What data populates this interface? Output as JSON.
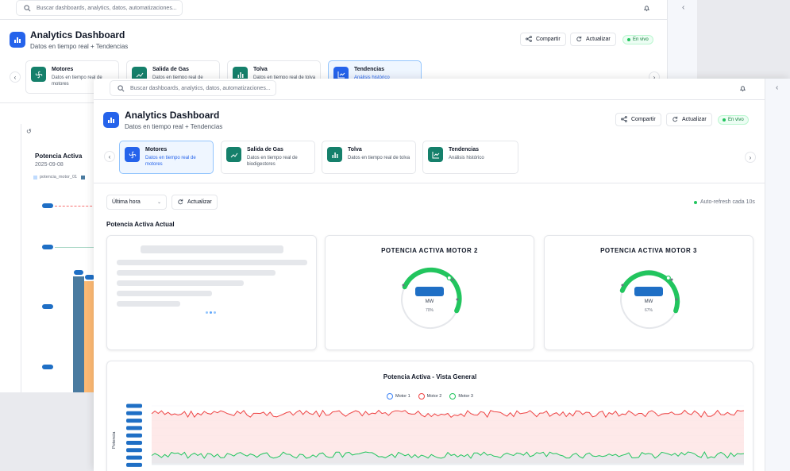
{
  "search": {
    "placeholder": "Buscar dashboards, analytics, datos, automatizaciones..."
  },
  "header": {
    "title": "Analytics Dashboard",
    "subtitle": "Datos en tiempo real + Tendencias"
  },
  "actions": {
    "share": "Compartir",
    "refresh": "Actualizar",
    "live": "En vivo"
  },
  "nav_cards": [
    {
      "title": "Motores",
      "desc": "Datos en tiempo real de motores",
      "icon": "fan-icon"
    },
    {
      "title": "Salida de Gas",
      "desc": "Datos en tiempo real de biodigestores",
      "icon": "trend-icon"
    },
    {
      "title": "Tolva",
      "desc": "Datos en tiempo real de tolva",
      "icon": "bar-chart-icon"
    },
    {
      "title": "Tendencias",
      "desc": "Análisis histórico",
      "icon": "line-chart-icon"
    }
  ],
  "back_cards": [
    {
      "title": "Motores",
      "desc": "Datos en tiempo real de motores"
    },
    {
      "title": "Salida de Gas",
      "desc": "Datos en tiempo real de biodigestores"
    },
    {
      "title": "Tolva",
      "desc": "Datos en tiempo real de tolva"
    },
    {
      "title": "Tendencias",
      "desc": "Análisis histórico"
    }
  ],
  "toolbar": {
    "range": "Última hora",
    "refresh": "Actualizar",
    "auto_refresh": "Auto-refresh cada 10s"
  },
  "section_title": "Potencia Activa Actual",
  "gauges": [
    {
      "title": "POTENCIA ACTIVA MOTOR 2",
      "unit": "MW",
      "percent_label": "70%",
      "percent": 0.7
    },
    {
      "title": "POTENCIA ACTIVA MOTOR 3",
      "unit": "MW",
      "percent_label": "67%",
      "percent": 0.67
    }
  ],
  "side_chart": {
    "title": "Potencia Activa",
    "date": "2025-09-08",
    "legend": "potencia_motor_01"
  },
  "overview": {
    "title": "Potencia Activa - Vista General",
    "ylabel": "Potencia",
    "legend": [
      {
        "name": "Motor 1",
        "color": "#3b82f6"
      },
      {
        "name": "Motor 2",
        "color": "#ef4444"
      },
      {
        "name": "Motor 3",
        "color": "#22c55e"
      }
    ]
  },
  "colors": {
    "accent": "#2563eb",
    "teal": "#15806b",
    "green": "#22c55e",
    "red": "#ef4444"
  }
}
